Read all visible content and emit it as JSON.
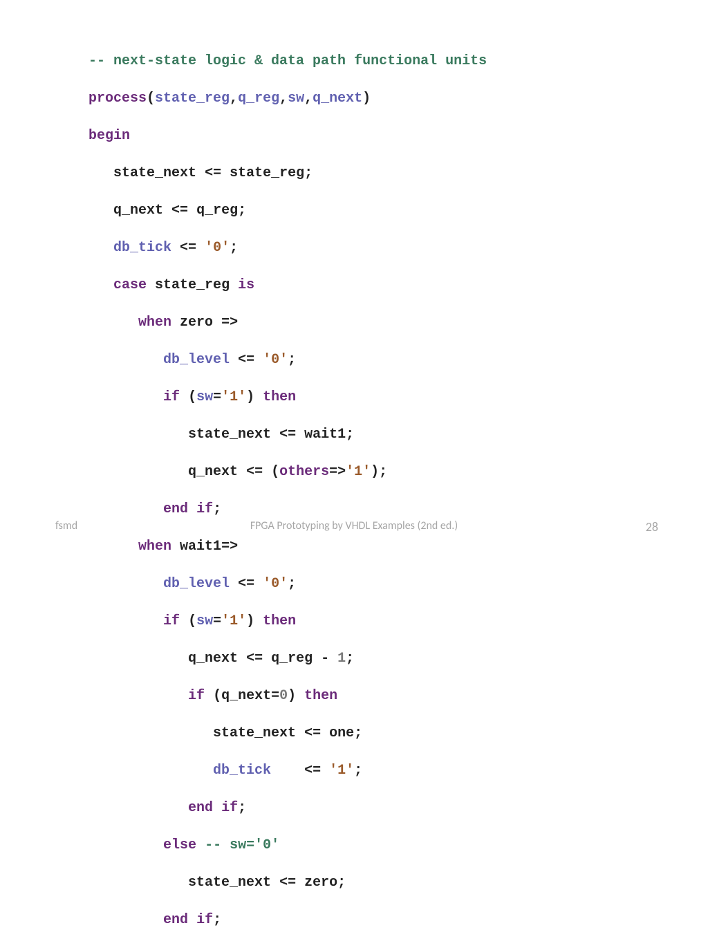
{
  "code": {
    "l1": {
      "comment": "-- next-state logic & data path functional units"
    },
    "l2": {
      "kw_process": "process",
      "lp": "(",
      "s1": "state_reg",
      "c1": ",",
      "s2": "q_reg",
      "c2": ",",
      "s3": "sw",
      "c3": ",",
      "s4": "q_next",
      "rp": ")"
    },
    "l3": {
      "kw_begin": "begin"
    },
    "l4": {
      "indent": "   ",
      "id1": "state_next",
      "sp1": " ",
      "op": "<=",
      "sp2": " ",
      "id2": "state_reg",
      "sc": ";"
    },
    "l5": {
      "indent": "   ",
      "id1": "q_next",
      "sp1": " ",
      "op": "<=",
      "sp2": " ",
      "id2": "q_reg",
      "sc": ";"
    },
    "l6": {
      "indent": "   ",
      "sig": "db_tick",
      "sp1": " ",
      "op": "<=",
      "sp2": " ",
      "str": "'0'",
      "sc": ";"
    },
    "l7": {
      "indent": "   ",
      "kw_case": "case",
      "sp1": " ",
      "id": "state_reg",
      "sp2": " ",
      "kw_is": "is"
    },
    "l8": {
      "indent": "      ",
      "kw_when": "when",
      "sp1": " ",
      "id": "zero",
      "sp2": " ",
      "arrow": "=>"
    },
    "l9": {
      "indent": "         ",
      "sig": "db_level",
      "sp1": " ",
      "op": "<=",
      "sp2": " ",
      "str": "'0'",
      "sc": ";"
    },
    "l10": {
      "indent": "         ",
      "kw_if": "if",
      "sp1": " ",
      "lp": "(",
      "sig": "sw",
      "eq": "=",
      "str": "'1'",
      "rp": ")",
      "sp2": " ",
      "kw_then": "then"
    },
    "l11": {
      "indent": "            ",
      "id1": "state_next",
      "sp1": " ",
      "op": "<=",
      "sp2": " ",
      "id2": "wait1",
      "sc": ";"
    },
    "l12": {
      "indent": "            ",
      "id1": "q_next",
      "sp1": " ",
      "op": "<=",
      "sp2": " ",
      "lp": "(",
      "kw_others": "others",
      "arrow": "=>",
      "str": "'1'",
      "rp": ")",
      "sc": ";"
    },
    "l13": {
      "indent": "         ",
      "kw_end": "end",
      "sp1": " ",
      "kw_if": "if",
      "sc": ";"
    },
    "l14": {
      "indent": "      ",
      "kw_when": "when",
      "sp1": " ",
      "id": "wait1",
      "arrow": "=>"
    },
    "l15": {
      "indent": "         ",
      "sig": "db_level",
      "sp1": " ",
      "op": "<=",
      "sp2": " ",
      "str": "'0'",
      "sc": ";"
    },
    "l16": {
      "indent": "         ",
      "kw_if": "if",
      "sp1": " ",
      "lp": "(",
      "sig": "sw",
      "eq": "=",
      "str": "'1'",
      "rp": ")",
      "sp2": " ",
      "kw_then": "then"
    },
    "l17": {
      "indent": "            ",
      "id1": "q_next",
      "sp1": " ",
      "op": "<=",
      "sp2": " ",
      "id2": "q_reg",
      "sp3": " ",
      "minus": "-",
      "sp4": " ",
      "num": "1",
      "sc": ";"
    },
    "l18": {
      "indent": "            ",
      "kw_if": "if",
      "sp1": " ",
      "lp": "(",
      "id": "q_next",
      "eq": "=",
      "num": "0",
      "rp": ")",
      "sp2": " ",
      "kw_then": "then"
    },
    "l19": {
      "indent": "               ",
      "id1": "state_next",
      "sp1": " ",
      "op": "<=",
      "sp2": " ",
      "id2": "one",
      "sc": ";"
    },
    "l20": {
      "indent": "               ",
      "sig": "db_tick",
      "pad": "    ",
      "op": "<=",
      "sp2": " ",
      "str": "'1'",
      "sc": ";"
    },
    "l21": {
      "indent": "            ",
      "kw_end": "end",
      "sp1": " ",
      "kw_if": "if",
      "sc": ";"
    },
    "l22": {
      "indent": "         ",
      "kw_else": "else",
      "sp1": " ",
      "comment": "-- sw='0'"
    },
    "l23": {
      "indent": "            ",
      "id1": "state_next",
      "sp1": " ",
      "op": "<=",
      "sp2": " ",
      "id2": "zero",
      "sc": ";"
    },
    "l24": {
      "indent": "         ",
      "kw_end": "end",
      "sp1": " ",
      "kw_if": "if",
      "sc": ";"
    }
  },
  "footer": {
    "left": "fsmd",
    "center": "FPGA Prototyping by VHDL Examples (2nd ed.)",
    "right": "28"
  }
}
